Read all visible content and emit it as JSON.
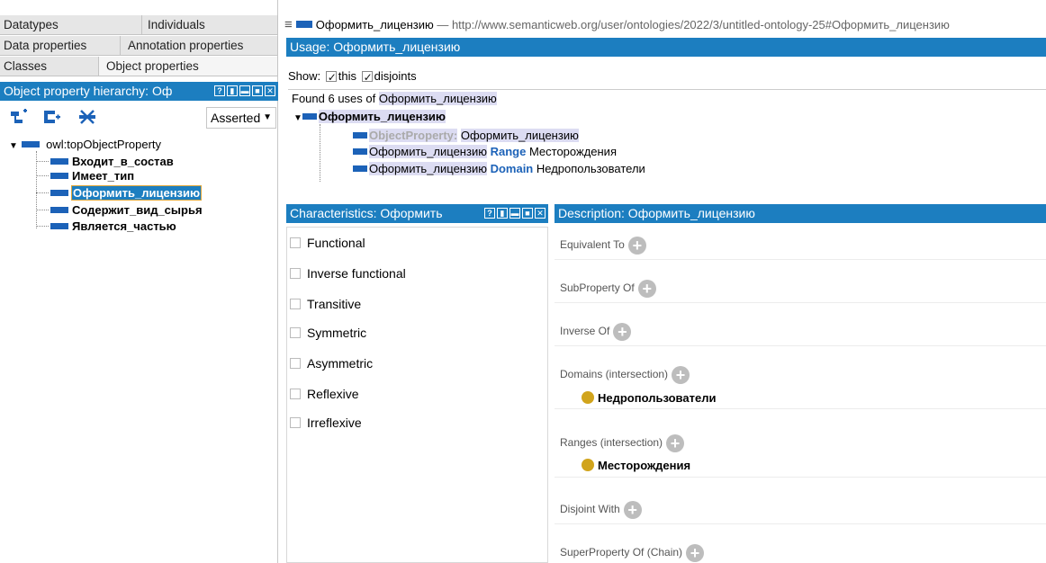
{
  "left_tabs": {
    "row1": [
      "Datatypes",
      "Individuals"
    ],
    "row2": [
      "Data properties",
      "Annotation properties"
    ],
    "row3": [
      "Classes",
      "Object properties"
    ]
  },
  "hierarchy": {
    "header": "Object property hierarchy: Оф",
    "header_icons": [
      "?",
      "▮",
      "▬",
      "■",
      "✕"
    ],
    "view_mode": "Asserted",
    "root": "owl:topObjectProperty",
    "children": [
      "Входит_в_состав",
      "Имеет_тип",
      "Оформить_лицензию",
      "Содержит_вид_сырья",
      "Является_частью"
    ],
    "selected": "Оформить_лицензию"
  },
  "title_bar": {
    "name": "Оформить_лицензию",
    "separator": " — ",
    "iri": "http://www.semanticweb.org/user/ontologies/2022/3/untitled-ontology-25#Оформить_лицензию"
  },
  "usage": {
    "header": "Usage: Оформить_лицензию",
    "show_label": "Show:",
    "show_this": "this",
    "show_disjoints": "disjoints",
    "found_prefix": "Found 6 uses of ",
    "found_name": "Оформить_лицензию",
    "root_entity": "Оформить_лицензию",
    "lines": [
      {
        "kw": "ObjectProperty:",
        "subject": "Оформить_лицензию"
      },
      {
        "subject": "Оформить_лицензию",
        "kw": "Range",
        "object": "Месторождения"
      },
      {
        "subject": "Оформить_лицензию",
        "kw": "Domain",
        "object": "Недропользователи"
      }
    ]
  },
  "characteristics": {
    "header": "Characteristics: Оформить",
    "items": [
      "Functional",
      "Inverse functional",
      "Transitive",
      "Symmetric",
      "Asymmetric",
      "Reflexive",
      "Irreflexive"
    ]
  },
  "description": {
    "header": "Description: Оформить_лицензию",
    "sections": [
      {
        "label": "Equivalent To",
        "items": []
      },
      {
        "label": "SubProperty Of",
        "items": []
      },
      {
        "label": "Inverse Of",
        "items": []
      },
      {
        "label": "Domains (intersection)",
        "items": [
          "Недропользователи"
        ]
      },
      {
        "label": "Ranges (intersection)",
        "items": [
          "Месторождения"
        ]
      },
      {
        "label": "Disjoint With",
        "items": []
      },
      {
        "label": "SuperProperty Of (Chain)",
        "items": []
      }
    ]
  },
  "colors": {
    "header_blue": "#1c7ec0",
    "entity_bar": "#1c62b8",
    "class_dot": "#d1a41c",
    "highlight": "#dcdcf2"
  }
}
